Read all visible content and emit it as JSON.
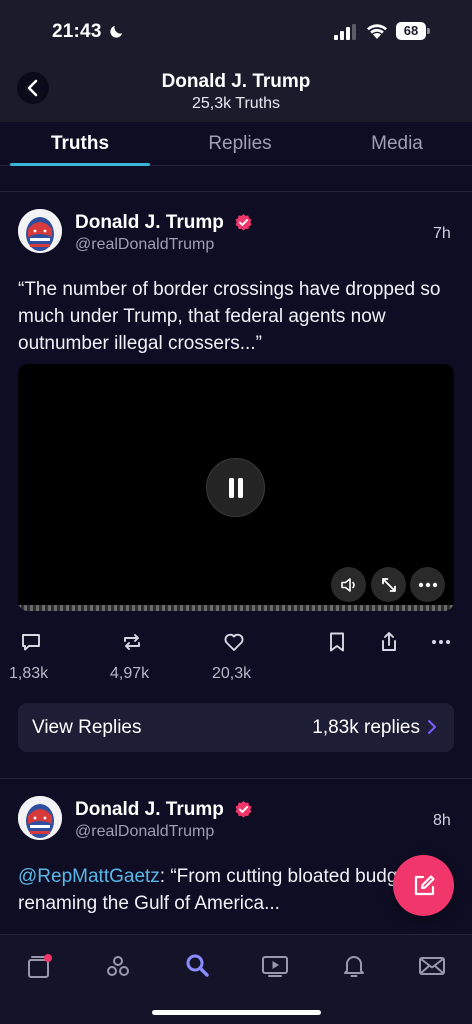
{
  "status_bar": {
    "time": "21:43",
    "battery": "68",
    "icons": [
      "moon-icon",
      "signal-icon",
      "wifi-icon",
      "battery-icon"
    ]
  },
  "header": {
    "title": "Donald J. Trump",
    "subtitle": "25,3k Truths",
    "back_icon": "chevron-left-icon"
  },
  "tabs": [
    {
      "label": "Truths",
      "active": true
    },
    {
      "label": "Replies",
      "active": false
    },
    {
      "label": "Media",
      "active": false
    }
  ],
  "posts": [
    {
      "name": "Donald J. Trump",
      "handle": "@realDonaldTrump",
      "time": "7h",
      "text": "“The number of border crossings have dropped so much under Trump, that federal agents now outnumber illegal crossers...”",
      "video": {
        "state": "playing",
        "controls": [
          "volume-icon",
          "fullscreen-icon",
          "more-icon"
        ]
      },
      "actions": {
        "replies": "1,83k",
        "retruths": "4,97k",
        "likes": "20,3k"
      },
      "view_replies": {
        "label": "View Replies",
        "count": "1,83k replies"
      }
    },
    {
      "name": "Donald J. Trump",
      "handle": "@realDonaldTrump",
      "time": "8h",
      "mention": "@RepMattGaetz",
      "text": ": “From cutting bloated budgets to renaming the Gulf of America..."
    }
  ],
  "fab": {
    "icon": "compose-icon"
  },
  "bottom_nav": [
    "home-icon",
    "groups-icon",
    "search-icon",
    "video-icon",
    "bell-icon",
    "mail-icon"
  ],
  "colors": {
    "background": "#0f0d24",
    "accent_tab": "#39b5d8",
    "fab": "#f0366a",
    "verified": "#f0366a",
    "mention": "#5ab8e8"
  }
}
